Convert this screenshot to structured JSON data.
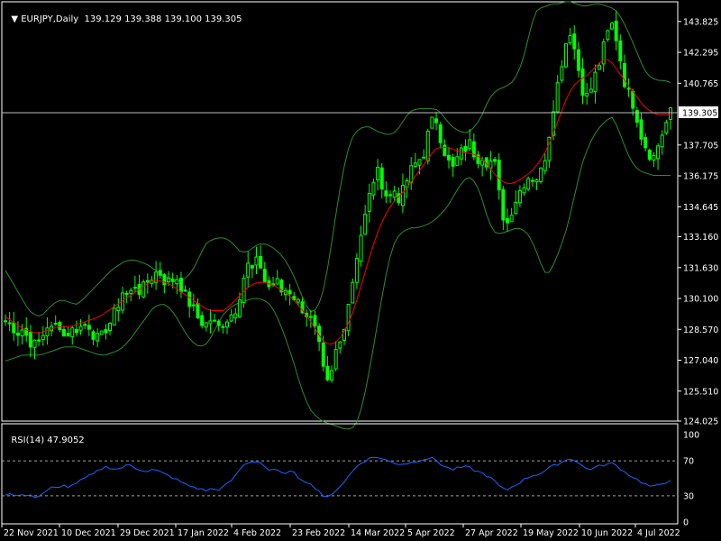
{
  "header": {
    "symbol_timeframe": "EURJPY,Daily",
    "ohlc": "139.129 139.388 139.100 139.305"
  },
  "rsi_header": {
    "label": "RSI(14) 47.9052"
  },
  "colors": {
    "background": "#000000",
    "bull_candle": "#00ff00",
    "bear_candle": "#00ff00",
    "bollinger": "#2e8b2e",
    "ma": "#ff0000",
    "rsi_line": "#1e64ff",
    "bid_line": "#c0c0c0",
    "grid_border": "#ffffff",
    "dashed_level": "#a0a0a0"
  },
  "chart_data": [
    {
      "type": "candlestick",
      "title": "EURJPY,Daily",
      "ylim": [
        124.025,
        144.8
      ],
      "y_ticks": [
        "143.825",
        "142.295",
        "140.765",
        "139.305",
        "137.705",
        "136.175",
        "134.645",
        "133.160",
        "131.630",
        "130.100",
        "128.570",
        "127.040",
        "125.510",
        "124.025"
      ],
      "current_price": "139.305",
      "x_ticks": [
        "22 Nov 2021",
        "10 Dec 2021",
        "29 Dec 2021",
        "17 Jan 2022",
        "4 Feb 2022",
        "23 Feb 2022",
        "14 Mar 2022",
        "5 Apr 2022",
        "27 Apr 2022",
        "19 May 2022",
        "10 Jun 2022",
        "4 Jul 2022"
      ],
      "close_path": [
        129.0,
        128.8,
        128.4,
        128.6,
        128.0,
        127.8,
        128.0,
        128.8,
        128.5,
        129.0,
        128.2,
        128.5,
        128.6,
        128.7,
        128.9,
        128.3,
        128.0,
        128.6,
        129.0,
        129.7,
        130.5,
        130.2,
        130.8,
        130.4,
        130.9,
        131.2,
        131.5,
        131.0,
        130.9,
        131.2,
        130.6,
        130.0,
        129.5,
        129.0,
        128.8,
        129.1,
        128.6,
        128.9,
        129.2,
        129.5,
        130.5,
        131.8,
        131.5,
        132.1,
        131.0,
        130.6,
        131.0,
        130.4,
        130.6,
        130.2,
        129.8,
        129.4,
        129.0,
        128.2,
        126.5,
        125.6,
        127.4,
        128.0,
        129.5,
        131.0,
        132.8,
        134.0,
        135.4,
        136.5,
        135.8,
        135.0,
        135.5,
        135.0,
        135.8,
        136.5,
        136.9,
        137.2,
        138.5,
        139.2,
        138.0,
        137.0,
        136.5,
        137.2,
        137.5,
        137.8,
        137.0,
        137.2,
        136.8,
        137.0,
        135.0,
        133.6,
        134.5,
        135.2,
        135.8,
        136.2,
        136.0,
        136.4,
        137.5,
        139.5,
        141.0,
        142.6,
        143.4,
        142.0,
        140.5,
        140.0,
        141.0,
        141.8,
        143.0,
        143.7,
        142.8,
        141.0,
        140.2,
        139.5,
        138.2,
        137.5,
        137.0,
        137.8,
        138.6,
        139.3
      ],
      "ma_path": [
        129.2,
        129.0,
        128.8,
        128.6,
        128.5,
        128.4,
        128.4,
        128.5,
        128.6,
        128.7,
        128.7,
        128.7,
        128.8,
        128.9,
        129.0,
        129.1,
        129.2,
        129.4,
        129.6,
        129.8,
        130.0,
        130.2,
        130.4,
        130.6,
        130.8,
        131.0,
        131.0,
        130.9,
        130.8,
        130.6,
        130.4,
        130.2,
        130.0,
        129.8,
        129.6,
        129.5,
        129.5,
        129.5,
        129.7,
        130.0,
        130.3,
        130.6,
        130.8,
        130.9,
        130.9,
        130.8,
        130.7,
        130.5,
        130.3,
        130.0,
        129.7,
        129.3,
        128.9,
        128.4,
        128.0,
        127.8,
        127.9,
        128.2,
        128.7,
        129.4,
        130.3,
        131.3,
        132.3,
        133.2,
        133.9,
        134.5,
        134.9,
        135.2,
        135.5,
        135.9,
        136.3,
        136.7,
        137.1,
        137.5,
        137.6,
        137.6,
        137.5,
        137.4,
        137.3,
        137.3,
        137.2,
        137.0,
        136.7,
        136.3,
        136.0,
        135.8,
        135.8,
        135.9,
        136.1,
        136.3,
        136.6,
        137.0,
        137.5,
        138.2,
        139.0,
        139.8,
        140.4,
        140.8,
        141.0,
        141.2,
        141.5,
        141.8,
        142.0,
        141.8,
        141.4,
        141.0,
        140.6,
        140.2,
        139.8,
        139.5,
        139.3,
        139.2,
        139.2,
        139.2
      ],
      "bb_upper_path": [
        131.5,
        131.0,
        130.5,
        130.0,
        129.5,
        129.3,
        129.2,
        129.5,
        129.8,
        130.0,
        130.0,
        129.9,
        129.8,
        130.0,
        130.3,
        130.6,
        130.9,
        131.2,
        131.5,
        131.7,
        131.9,
        132.0,
        132.0,
        131.9,
        131.8,
        131.6,
        131.4,
        131.2,
        131.1,
        131.0,
        131.0,
        131.2,
        131.6,
        132.2,
        132.8,
        133.0,
        133.1,
        133.1,
        133.0,
        132.7,
        132.4,
        132.4,
        132.6,
        132.8,
        132.8,
        132.7,
        132.5,
        132.2,
        131.8,
        131.2,
        130.5,
        129.8,
        129.4,
        129.6,
        130.5,
        132.0,
        134.0,
        135.8,
        137.3,
        138.1,
        138.5,
        138.6,
        138.6,
        138.4,
        138.3,
        138.2,
        138.3,
        138.6,
        139.1,
        139.4,
        139.5,
        139.5,
        139.5,
        139.5,
        139.3,
        138.9,
        138.6,
        138.4,
        138.3,
        138.4,
        138.7,
        139.2,
        139.9,
        140.3,
        140.5,
        140.6,
        140.8,
        141.2,
        142.0,
        143.2,
        144.3,
        144.5,
        144.6,
        144.7,
        144.7,
        144.8,
        144.8,
        144.7,
        144.6,
        144.6,
        144.7,
        144.7,
        144.6,
        144.5,
        144.3,
        143.8,
        143.2,
        142.5,
        141.8,
        141.2,
        141.0,
        140.9,
        140.9,
        140.8
      ],
      "bb_lower_path": [
        127.0,
        127.1,
        127.2,
        127.3,
        127.3,
        127.3,
        127.3,
        127.4,
        127.5,
        127.6,
        127.7,
        127.7,
        127.7,
        127.6,
        127.5,
        127.4,
        127.3,
        127.3,
        127.4,
        127.5,
        127.7,
        128.0,
        128.4,
        128.8,
        129.2,
        129.6,
        129.8,
        129.8,
        129.6,
        129.2,
        128.7,
        128.2,
        127.9,
        127.7,
        127.8,
        128.2,
        128.8,
        129.3,
        129.6,
        129.8,
        129.9,
        130.0,
        130.1,
        130.1,
        130.0,
        129.8,
        129.3,
        128.6,
        127.8,
        126.9,
        125.9,
        125.1,
        124.5,
        124.2,
        124.0,
        123.9,
        123.8,
        123.7,
        123.6,
        123.7,
        124.1,
        125.3,
        126.8,
        128.5,
        130.2,
        131.8,
        132.8,
        133.3,
        133.5,
        133.6,
        133.6,
        133.7,
        133.8,
        134.0,
        134.3,
        134.6,
        135.1,
        135.6,
        136.0,
        136.1,
        135.8,
        135.0,
        134.0,
        133.4,
        133.3,
        133.4,
        133.5,
        133.6,
        133.5,
        133.2,
        132.6,
        131.8,
        131.2,
        131.7,
        132.4,
        133.2,
        134.3,
        135.6,
        136.8,
        137.6,
        138.2,
        138.6,
        138.9,
        139.1,
        138.6,
        137.8,
        137.1,
        136.6,
        136.4,
        136.3,
        136.2,
        136.2,
        136.2,
        136.2
      ]
    },
    {
      "type": "line",
      "title": "RSI(14) 47.9052",
      "ylim": [
        0,
        100
      ],
      "y_ticks": [
        "100",
        "70",
        "30",
        "0"
      ],
      "levels": [
        70,
        30
      ],
      "values": [
        32,
        33,
        30,
        31,
        30,
        29,
        31,
        36,
        40,
        38,
        42,
        40,
        45,
        48,
        52,
        55,
        60,
        63,
        62,
        60,
        63,
        66,
        62,
        60,
        58,
        60,
        58,
        55,
        52,
        49,
        45,
        42,
        40,
        38,
        36,
        38,
        37,
        40,
        45,
        52,
        62,
        68,
        69,
        70,
        64,
        58,
        60,
        55,
        58,
        56,
        50,
        47,
        42,
        38,
        30,
        27,
        36,
        42,
        50,
        58,
        66,
        70,
        73,
        75,
        72,
        70,
        68,
        66,
        67,
        68,
        70,
        72,
        73,
        72,
        66,
        62,
        60,
        62,
        63,
        62,
        58,
        56,
        52,
        48,
        40,
        36,
        40,
        44,
        48,
        52,
        54,
        56,
        60,
        64,
        67,
        70,
        73,
        70,
        64,
        60,
        62,
        64,
        66,
        67,
        64,
        58,
        54,
        50,
        46,
        42,
        40,
        42,
        45,
        47.9
      ]
    }
  ]
}
